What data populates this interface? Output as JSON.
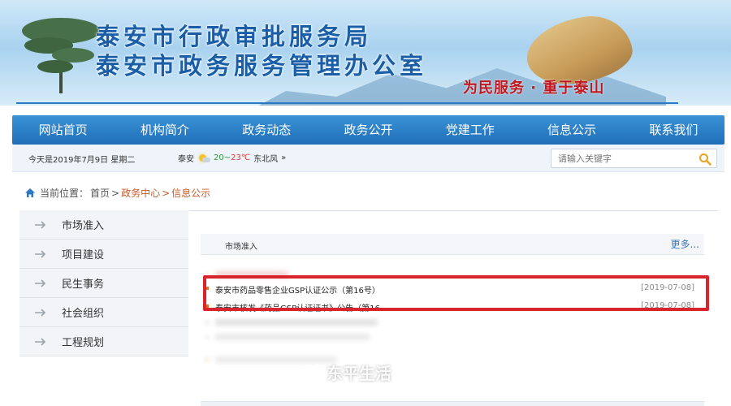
{
  "banner": {
    "title_line1": "泰安市行政审批服务局",
    "title_line2": "泰安市政务服务管理办公室",
    "slogan": "为民服务 · 重于泰山"
  },
  "nav": {
    "items": [
      {
        "label": "网站首页"
      },
      {
        "label": "机构简介"
      },
      {
        "label": "政务动态"
      },
      {
        "label": "政务公开"
      },
      {
        "label": "党建工作"
      },
      {
        "label": "信息公示"
      },
      {
        "label": "联系我们"
      }
    ]
  },
  "infobar": {
    "date": "今天是2019年7月9日 星期二",
    "city": "泰安",
    "weather_icon": "sun-cloud-icon",
    "temp_low": "20",
    "temp_sep": "~",
    "temp_high": "23℃",
    "wind": "东北风",
    "more_symbol": "»"
  },
  "search": {
    "placeholder": "请输入关键字"
  },
  "breadcrumb": {
    "prefix": "当前位置：",
    "home": "首页",
    "sep": ">",
    "level2": "政务中心",
    "level3": "信息公示"
  },
  "sidebar": {
    "items": [
      {
        "label": "市场准入"
      },
      {
        "label": "项目建设"
      },
      {
        "label": "民生事务"
      },
      {
        "label": "社会组织"
      },
      {
        "label": "工程规划"
      }
    ]
  },
  "section": {
    "title": "市场准入",
    "more": "更多..."
  },
  "list": {
    "rows": [
      {
        "title": "泰安市药品零售企业GSP认证公示（第16号）",
        "date": "[2019-07-08]"
      },
      {
        "title": "泰安市核发《药品GSP认证证书》公告（第16...",
        "date": "[2019-07-08]"
      }
    ]
  },
  "watermark": {
    "text": "东平生活"
  },
  "colors": {
    "nav_bg": "#2a80c8",
    "title_blue": "#1b5ea8",
    "slogan_red": "#c0161d",
    "highlight_red": "#d8242c",
    "bullet_orange": "#e5702a",
    "crumb_active": "#c45a2a"
  }
}
